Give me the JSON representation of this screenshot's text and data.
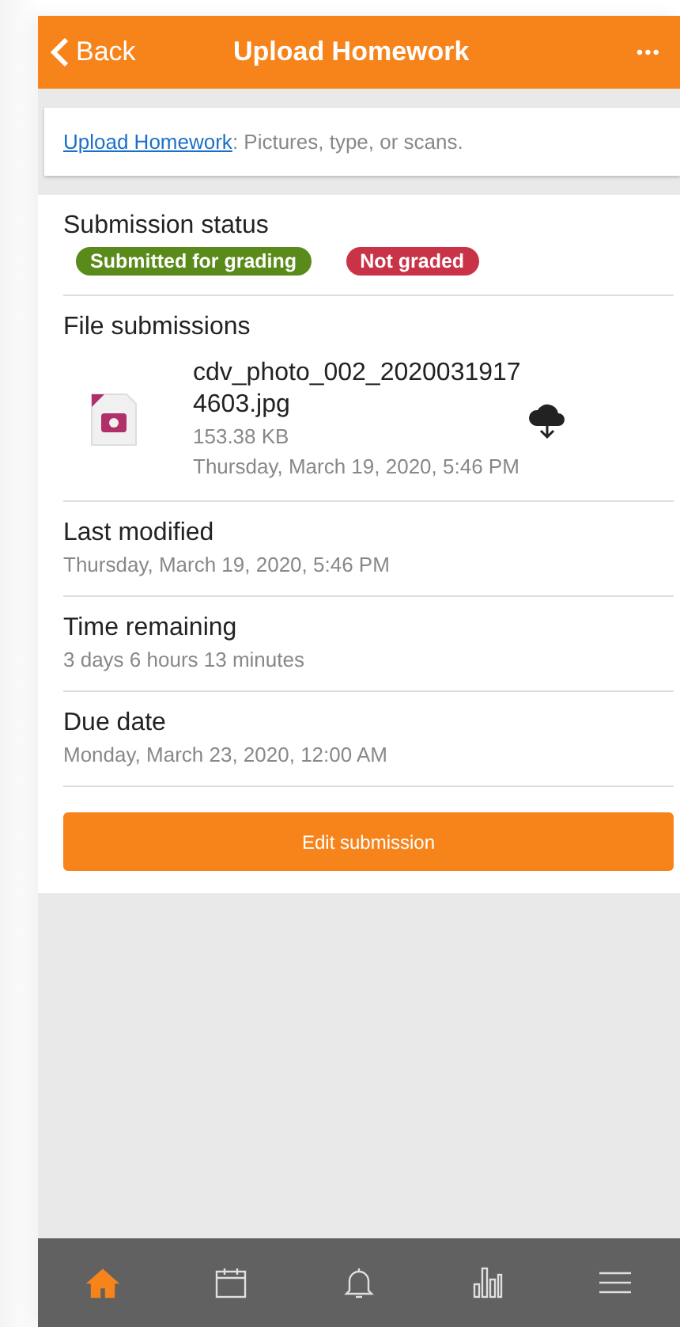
{
  "header": {
    "back": "Back",
    "title": "Upload Homework",
    "more": "•••"
  },
  "intro": {
    "link": "Upload Homework",
    "text": ": Pictures, type, or scans."
  },
  "status": {
    "heading": "Submission status",
    "badges": [
      {
        "label": "Submitted for grading",
        "color": "#5a8a1a"
      },
      {
        "label": "Not graded",
        "color": "#c93347"
      }
    ]
  },
  "files": {
    "heading": "File submissions",
    "items": [
      {
        "name": "cdv_photo_002_20200319174603.jpg",
        "size": "153.38 KB",
        "date": "Thursday, March 19, 2020, 5:46 PM"
      }
    ]
  },
  "fields": [
    {
      "label": "Last modified",
      "value": "Thursday, March 19, 2020, 5:46 PM"
    },
    {
      "label": "Time remaining",
      "value": "3 days 6 hours 13 minutes"
    },
    {
      "label": "Due date",
      "value": "Monday, March 23, 2020, 12:00 AM"
    }
  ],
  "edit_button": "Edit submission",
  "nav": [
    {
      "kind": "home",
      "selected": true
    },
    {
      "kind": "calendar",
      "selected": false
    },
    {
      "kind": "bell",
      "selected": false
    },
    {
      "kind": "chart",
      "selected": false
    },
    {
      "kind": "menu",
      "selected": false
    }
  ]
}
